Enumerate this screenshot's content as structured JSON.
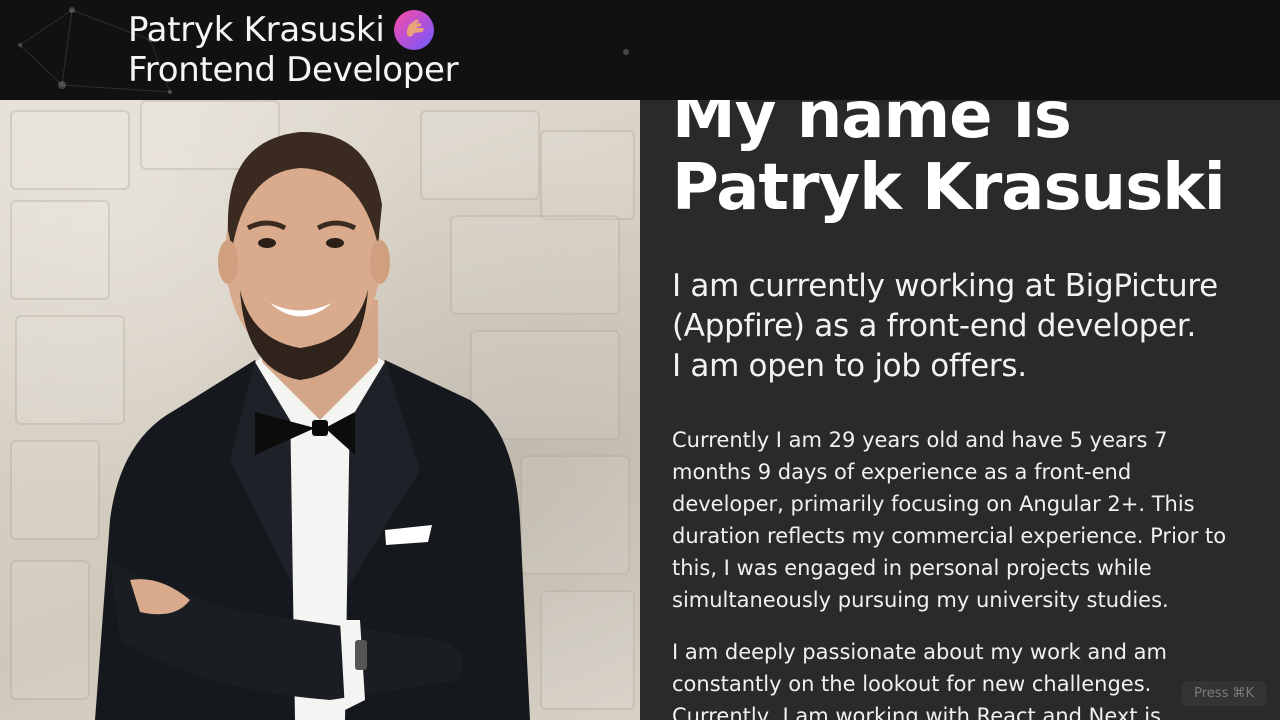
{
  "header": {
    "name": "Patryk Krasuski",
    "role": "Frontend Developer",
    "name_icon": "waving-hand-icon"
  },
  "photo": {
    "alt": "Portrait of Patryk Krasuski in a tuxedo"
  },
  "main": {
    "title": "My name is Patryk Krasuski",
    "lead_line_1": "I am currently working at BigPicture",
    "lead_line_2": "(Appfire) as a front-end developer.",
    "lead_line_3": "I am open to job offers.",
    "paragraph_1": "Currently I am 29 years old and have 5 years 7 months 9 days of experience as a front-end developer, primarily focusing on Angular 2+. This duration reflects my commercial experience. Prior to this, I was engaged in personal projects while simultaneously pursuing my university studies.",
    "paragraph_2": "I am deeply passionate about my work and am constantly on the lookout for new challenges. Currently, I am working with React and Next.js."
  },
  "command_hint": "Press ⌘K",
  "colors": {
    "header_bg": "#111111",
    "content_bg": "#2a2a2a",
    "text": "#f2f2f2",
    "icon_gradient_start": "#ff4fa0",
    "icon_gradient_end": "#6d5cff"
  }
}
